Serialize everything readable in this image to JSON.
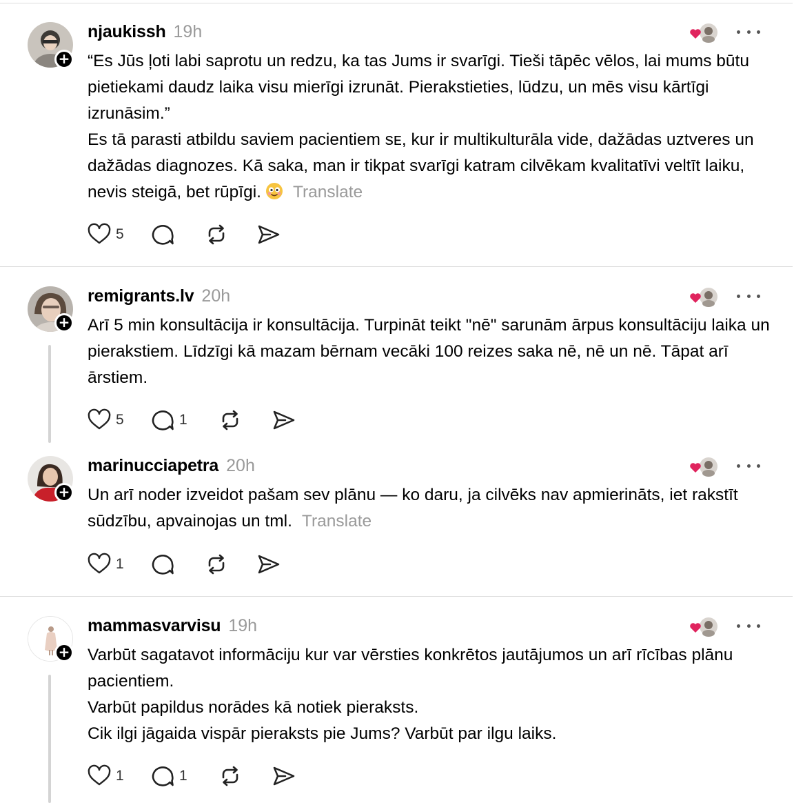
{
  "posts": [
    {
      "username": "njaukissh",
      "time": "19h",
      "paragraphs": [
        "“Es Jūs ļoti labi saprotu un redzu, ka tas Jums ir svarīgi. Tieši tāpēc vēlos, lai mums būtu pietiekami daudz laika visu mierīgi izrunāt. Pierakstieties, lūdzu, un mēs visu kārtīgi izrunāsim.”",
        "Es tā parasti atbildu saviem pacientiem sᴇ, kur ir multikulturāla vide, dažādas uztveres un dažādas diagnozes. Kā saka, man ir tikpat svarīgi katram cilvēkam kvalitatīvi veltīt laiku, nevis steigā, bet rūpīgi."
      ],
      "translate_label": "Translate",
      "likes": "5",
      "replies": ""
    },
    {
      "username": "remigrants.lv",
      "time": "20h",
      "paragraphs": [
        "Arī 5 min konsultācija ir konsultācija. Turpināt teikt \"nē\" sarunām ārpus konsultāciju laika un pierakstiem. Līdzīgi kā mazam bērnam vecāki 100 reizes saka nē, nē un nē. Tāpat arī ārstiem."
      ],
      "translate_label": "",
      "likes": "5",
      "replies": "1"
    },
    {
      "username": "marinucciapetra",
      "time": "20h",
      "paragraphs": [
        "Un arī noder izveidot pašam sev plānu — ko daru, ja cilvēks nav apmierināts, iet rakstīt sūdzību, apvainojas un tml."
      ],
      "translate_label": "Translate",
      "likes": "1",
      "replies": ""
    },
    {
      "username": "mammasvarvisu",
      "time": "19h",
      "paragraphs": [
        "Varbūt sagatavot informāciju kur var vērsties konkrētos jautājumos un arī rīcības plānu pacientiem.",
        "Varbūt papildus norādes kā notiek pieraksts.",
        "Cik ilgi jāgaida vispār pieraksts pie Jums? Varbūt par ilgu laiks."
      ],
      "translate_label": "",
      "likes": "1",
      "replies": "1"
    }
  ],
  "icons": {
    "like": "heart-icon",
    "reply": "comment-icon",
    "repost": "repost-icon",
    "share": "send-icon",
    "more": "more-icon",
    "follow": "plus-icon"
  },
  "colors": {
    "text": "#000000",
    "muted": "#9a9a9a",
    "divider": "#dcdcdc",
    "liked_heart": "#e0245e"
  }
}
